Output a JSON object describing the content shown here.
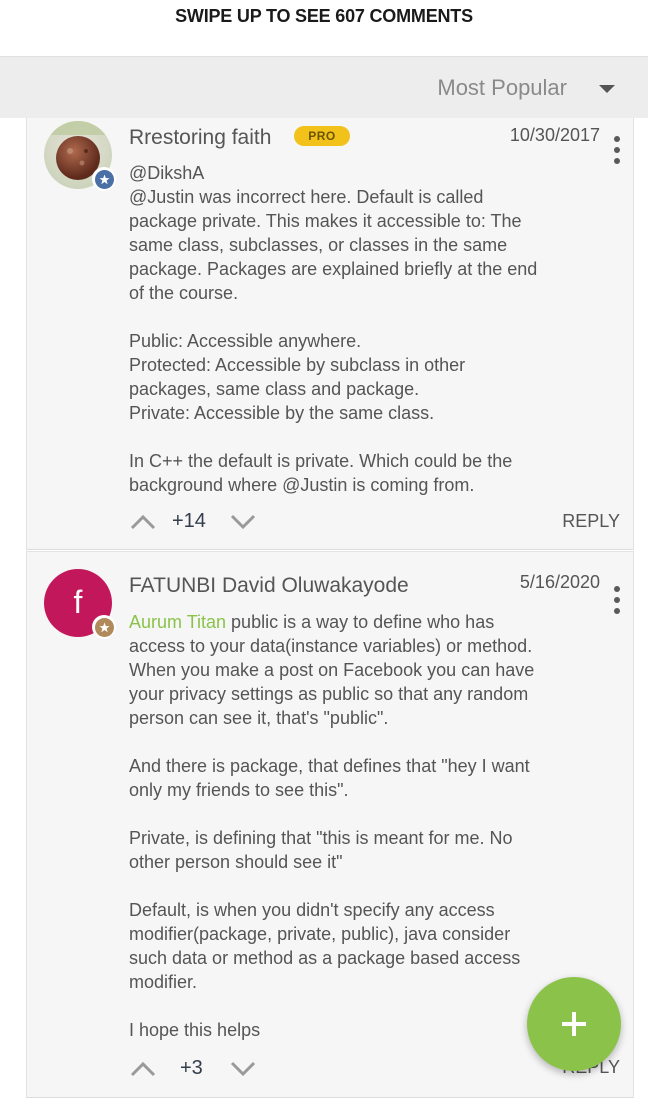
{
  "header": {
    "swipe_text": "SWIPE UP TO SEE 607 COMMENTS"
  },
  "sort": {
    "label": "Most Popular"
  },
  "comments": [
    {
      "author": "Rrestoring faith",
      "tag": "PRO",
      "date": "10/30/2017",
      "lines": [
        "@DikshA",
        "@Justin was incorrect here. Default is called",
        "package private. This makes it accessible to: The",
        "same class, subclasses, or classes in the same",
        "package. Packages are explained briefly at the end",
        "of the course.",
        "",
        "Public: Accessible anywhere.",
        "Protected: Accessible by subclass in other",
        "packages, same class and package.",
        "Private: Accessible by the same class.",
        "",
        "In C++ the default is private. Which could be the",
        "background where @Justin is coming from."
      ],
      "votes": "+14",
      "reply_label": "REPLY",
      "badge_color": "#4a6fa5"
    },
    {
      "author": "FATUNBI David Oluwakayode",
      "avatar_letter": "f",
      "date": "5/16/2020",
      "mention": "Aurum Titan",
      "first_line_rest": " public is a way to define who has",
      "lines": [
        "access to your data(instance variables) or method.",
        "When you make a post on Facebook you can have",
        "your privacy settings as public so that any random",
        "person can see it, that's \"public\".",
        "",
        "And there is package, that defines that \"hey I want",
        "only my friends to see this\".",
        "",
        "Private, is defining that \"this is meant for me. No",
        "other person should see it\"",
        "",
        "Default, is when you didn't specify any access",
        "modifier(package, private, public), java consider",
        "such data or method as a package based access",
        "modifier.",
        "",
        "I hope this helps"
      ],
      "votes": "+3",
      "reply_label": "REPLY",
      "badge_color": "#b08a5a"
    }
  ],
  "fab": {
    "icon": "plus-icon"
  },
  "colors": {
    "accent": "#8bc34a",
    "pro": "#f2c21b",
    "avatar_f": "#c2185b"
  }
}
